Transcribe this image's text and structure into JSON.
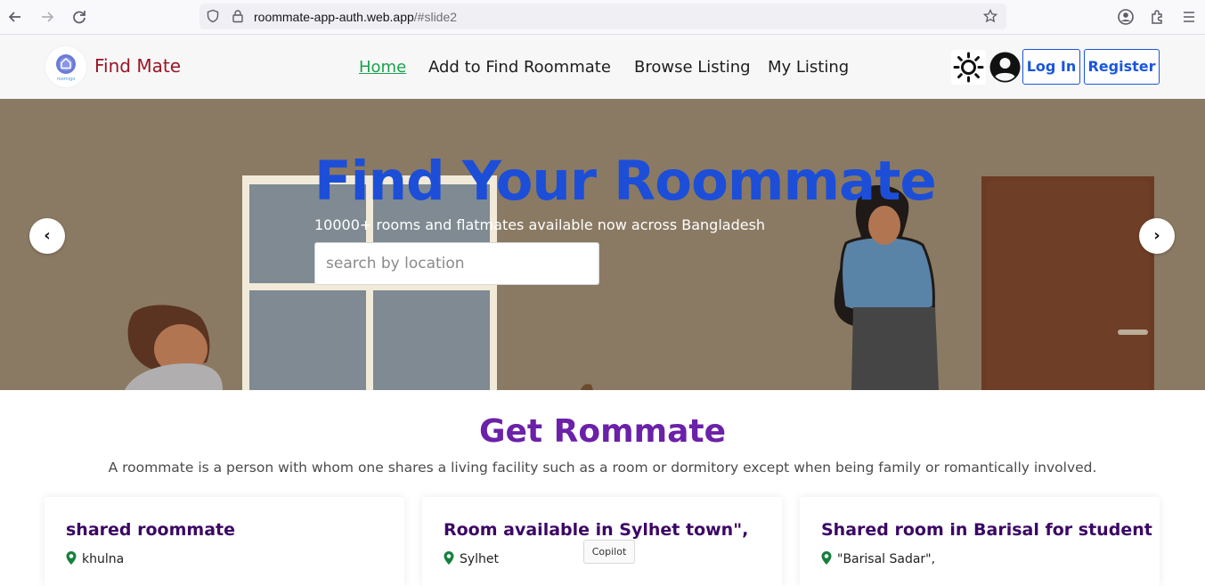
{
  "browser": {
    "url_host": "roommate-app-auth.web.app",
    "url_path": "/#slide2"
  },
  "navbar": {
    "brand": "Find Mate",
    "logo_text": "roomigo",
    "links": [
      {
        "label": "Home",
        "active": true
      },
      {
        "label": "Add to Find Roommate",
        "active": false
      },
      {
        "label": "Browse Listing",
        "active": false
      },
      {
        "label": "My Listing",
        "active": false
      }
    ],
    "login_label": "Log In",
    "register_label": "Register"
  },
  "hero": {
    "title": "Find Your Roommate",
    "subtitle": "10000+ rooms and flatmates available now across Bangladesh",
    "search_placeholder": "search by location",
    "prev_label": "‹",
    "next_label": "›"
  },
  "section": {
    "title": "Get Rommate",
    "description": "A roommate is a person with whom one shares a living facility such as a room or dormitory except when being family or romantically involved."
  },
  "cards": [
    {
      "title": "shared roommate",
      "location": "khulna"
    },
    {
      "title": "Room available in Sylhet town\",",
      "location": "Sylhet"
    },
    {
      "title": "Shared room in Barisal for student",
      "location": "\"Barisal Sadar\","
    }
  ],
  "tooltip": "Copilot",
  "colors": {
    "brand": "#9b1424",
    "accent_blue": "#1d4ed8",
    "nav_active": "#1aa14e",
    "section_title": "#6b21a8",
    "location_pin": "#15803d"
  }
}
